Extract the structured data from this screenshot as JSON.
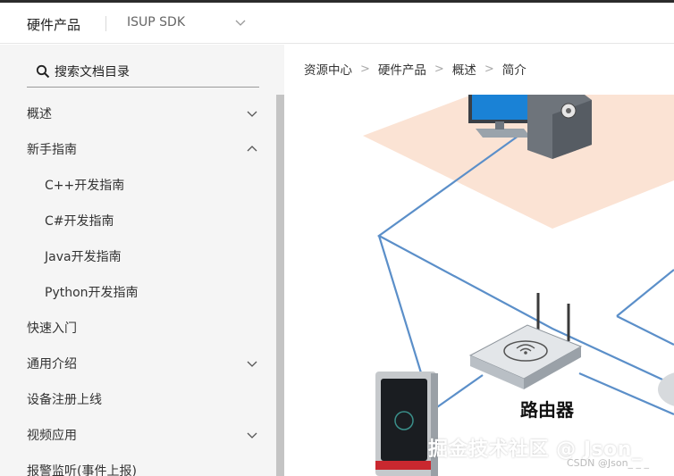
{
  "header": {
    "product": "硬件产品",
    "sdk_selector": "ISUP SDK"
  },
  "sidebar": {
    "search_placeholder": "搜索文档目录",
    "items": [
      {
        "label": "概述",
        "level": 1,
        "chevron": "down"
      },
      {
        "label": "新手指南",
        "level": 1,
        "chevron": "up"
      },
      {
        "label": "C++开发指南",
        "level": 2
      },
      {
        "label": "C#开发指南",
        "level": 2
      },
      {
        "label": "Java开发指南",
        "level": 2
      },
      {
        "label": "Python开发指南",
        "level": 2
      },
      {
        "label": "快速入门",
        "level": 1
      },
      {
        "label": "通用介绍",
        "level": 1,
        "chevron": "down"
      },
      {
        "label": "设备注册上线",
        "level": 1
      },
      {
        "label": "视频应用",
        "level": 1,
        "chevron": "down"
      },
      {
        "label": "报警监听(事件上报)",
        "level": 1
      }
    ]
  },
  "breadcrumb": [
    "资源中心",
    "硬件产品",
    "概述",
    "简介"
  ],
  "diagram": {
    "router_label": "路由器"
  },
  "watermark": {
    "main": "掘金技术社区 @ Json_",
    "small": "CSDN @Json_ _ _"
  },
  "colors": {
    "sidebar_bg": "#f5f5f5",
    "network_line": "#5b8fc9",
    "floor_tint": "#fbe3d4"
  }
}
